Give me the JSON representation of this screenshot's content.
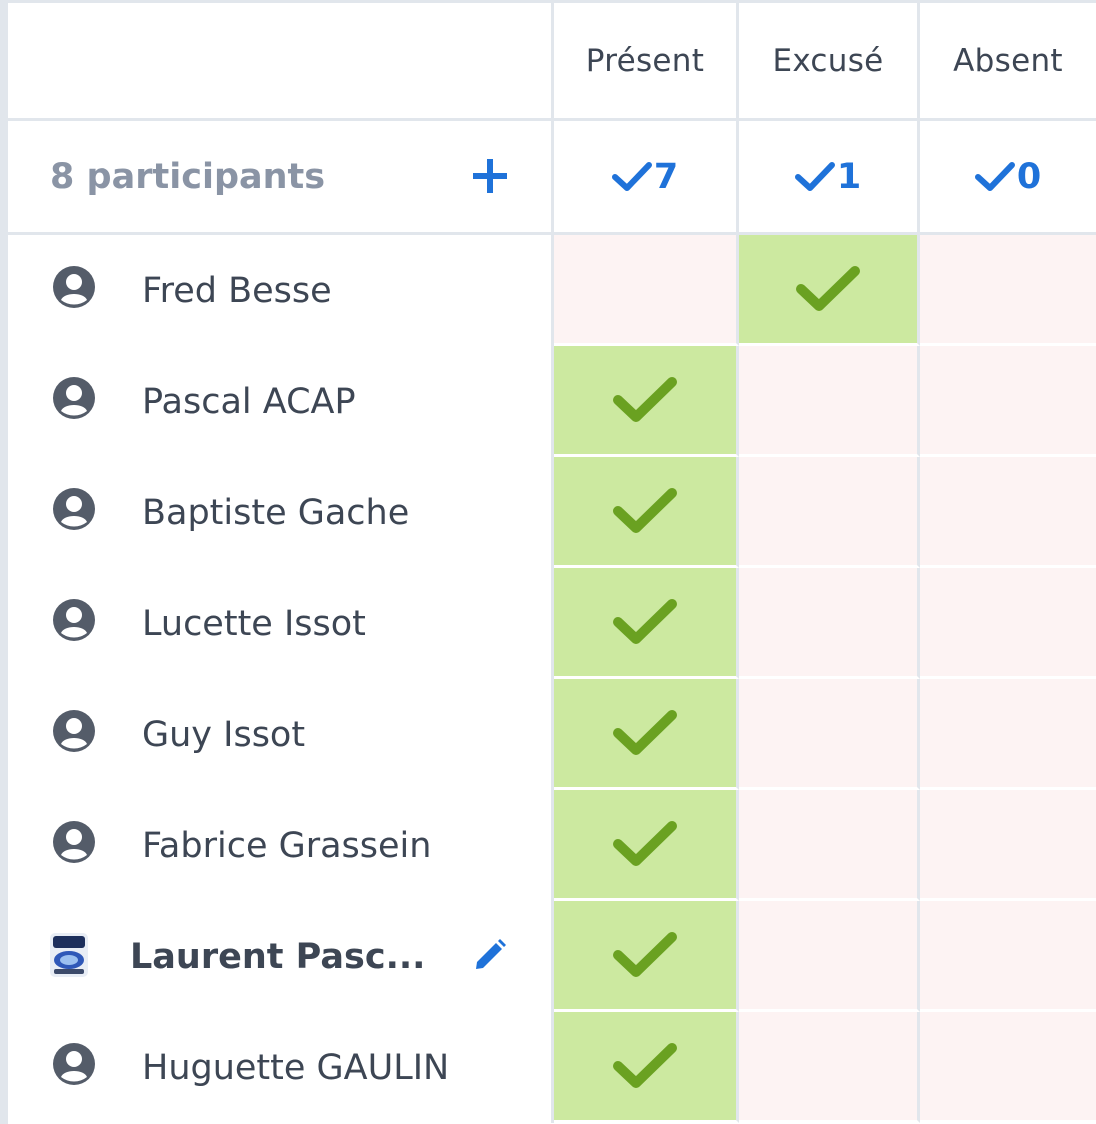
{
  "columns": [
    {
      "label": "Présent",
      "count": "7"
    },
    {
      "label": "Excusé",
      "count": "1"
    },
    {
      "label": "Absent",
      "count": "0"
    }
  ],
  "summary": {
    "participants_label": "8 participants",
    "add_icon": "plus-icon",
    "count_icon": "check-icon"
  },
  "colors": {
    "accent": "#1f72d9",
    "selected_cell": "#cce9a0",
    "unselected_cell": "#fdf3f3",
    "check": "#6aa121",
    "muted_text": "#8a94a5",
    "text": "#3d4654"
  },
  "participants": [
    {
      "name": "Fred Besse",
      "status": "Excusé",
      "avatar": "user-circle-icon"
    },
    {
      "name": "Pascal ACAP",
      "status": "Présent",
      "avatar": "user-circle-icon"
    },
    {
      "name": "Baptiste Gache",
      "status": "Présent",
      "avatar": "user-circle-icon"
    },
    {
      "name": "Lucette Issot",
      "status": "Présent",
      "avatar": "user-circle-icon"
    },
    {
      "name": "Guy Issot",
      "status": "Présent",
      "avatar": "user-circle-icon"
    },
    {
      "name": "Fabrice Grassein",
      "status": "Présent",
      "avatar": "user-circle-icon"
    },
    {
      "name": "Laurent Pasc...",
      "status": "Présent",
      "avatar": "club-logo-image",
      "current_user": true,
      "edit_icon": "pencil-icon"
    },
    {
      "name": "Huguette GAULIN",
      "status": "Présent",
      "avatar": "user-circle-icon"
    }
  ]
}
